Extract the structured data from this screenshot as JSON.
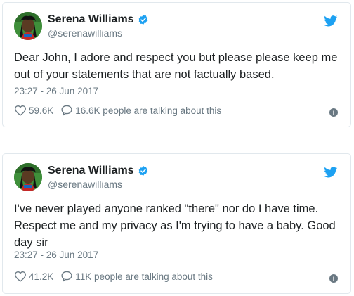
{
  "colors": {
    "twitter_blue": "#1da1f2",
    "verified_blue": "#1da1f2",
    "secondary_text": "#697882",
    "primary_text": "#1c2022",
    "border": "#e1e8ed"
  },
  "icons": {
    "brand": "twitter-bird-icon",
    "verified": "verified-badge-icon",
    "like": "heart-icon",
    "reply": "speech-bubble-icon",
    "info": "info-icon"
  },
  "tweets": [
    {
      "author_name": "Serena Williams",
      "handle": "@serenawilliams",
      "text": "Dear John, I adore and respect you but please please keep me out of your statements that are not factually based.",
      "timestamp": "23:27 - 26 Jun 2017",
      "likes": "59.6K",
      "talking": "16.6K people are talking about this"
    },
    {
      "author_name": "Serena Williams",
      "handle": "@serenawilliams",
      "text": "I've never played anyone ranked \"there\" nor do I have time. Respect me and my privacy as I'm trying to have a baby. Good day sir",
      "timestamp": "23:27 - 26 Jun 2017",
      "likes": "41.2K",
      "talking": "11K people are talking about this"
    }
  ]
}
